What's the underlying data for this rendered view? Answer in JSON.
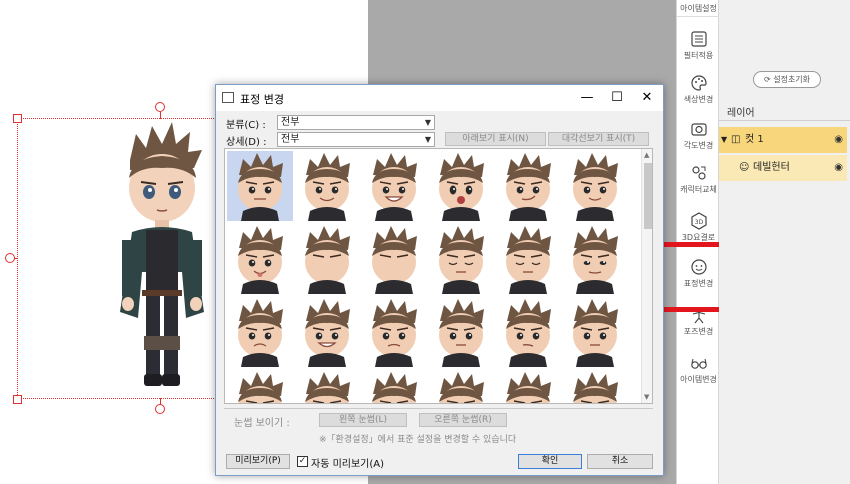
{
  "toolbar": {
    "header": "아이템설정",
    "tools": [
      {
        "label": "필터적용",
        "icon": "filter-icon"
      },
      {
        "label": "색상변경",
        "icon": "palette-icon"
      },
      {
        "label": "각도변경",
        "icon": "camera-icon"
      },
      {
        "label": "캐릭터교체",
        "icon": "character-swap-icon"
      },
      {
        "label": "3D요결로",
        "icon": "3d-icon"
      },
      {
        "label": "표정변경",
        "icon": "face-icon"
      },
      {
        "label": "포즈변경",
        "icon": "pose-icon"
      },
      {
        "label": "아이템변경",
        "icon": "glasses-icon"
      }
    ],
    "highlight_color": "#e3161e"
  },
  "layer_panel": {
    "reset_label": "설정초기화",
    "title": "레이어",
    "layers": [
      {
        "name": "컷 1",
        "level": 0
      },
      {
        "name": "데빌헌터",
        "level": 1
      }
    ]
  },
  "dialog": {
    "title": "표정 변경",
    "category_label": "분류(C) :",
    "category_value": "전부",
    "detail_label": "상세(D) :",
    "detail_value": "전부",
    "btn_preview_below": "아래보기 표시(N)",
    "btn_preview_diag": "대각선보기 표시(T)",
    "eyeline_label": "눈썹 보이기 :",
    "btn_left_eye": "왼쪽 눈썹(L)",
    "btn_right_eye": "오른쪽 눈썹(R)",
    "note": "※「환경설정」에서 표준 설정을 변경할 수 있습니다",
    "preview_btn": "미리보기(P)",
    "auto_preview_label": "자동 미리보기(A)",
    "auto_preview_checked": true,
    "ok_btn": "확인",
    "cancel_btn": "취소",
    "expressions": [
      [
        "neutral",
        "smile",
        "grin",
        "shocked",
        "smirk",
        "smile-soft"
      ],
      [
        "tongue",
        "blank",
        "blank-2",
        "eyes-closed",
        "sleepy",
        "squint"
      ],
      [
        "frown",
        "fangs",
        "angry",
        "calm",
        "doubt",
        "serious"
      ],
      [
        "partial",
        "partial",
        "partial",
        "partial",
        "partial",
        "partial"
      ]
    ]
  }
}
